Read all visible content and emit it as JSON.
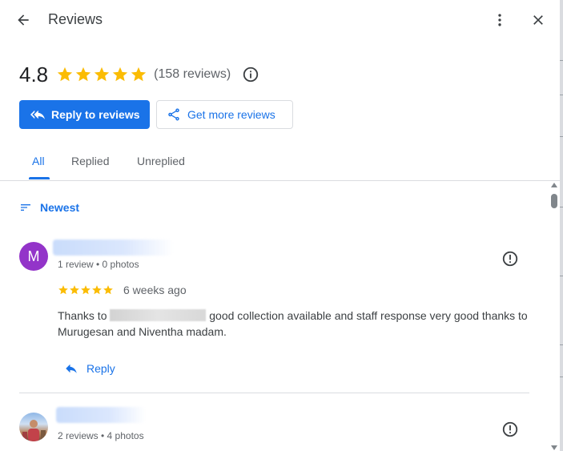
{
  "header": {
    "title": "Reviews",
    "back_icon": "arrow-back-icon",
    "more_icon": "more-vert-icon",
    "close_icon": "close-icon"
  },
  "summary": {
    "rating": "4.8",
    "stars": 5,
    "review_count": "(158 reviews)",
    "info_icon": "info-icon"
  },
  "actions": {
    "reply_label": "Reply to reviews",
    "get_more_label": "Get more reviews"
  },
  "tabs": [
    {
      "label": "All",
      "active": true
    },
    {
      "label": "Replied",
      "active": false
    },
    {
      "label": "Unreplied",
      "active": false
    }
  ],
  "sort": {
    "label": "Newest",
    "icon": "sort-icon"
  },
  "reviews": [
    {
      "avatar_letter": "M",
      "avatar_color": "#9334c9",
      "meta": "1 review • 0 photos",
      "stars": 5,
      "time": "6 weeks ago",
      "text_before": "Thanks to",
      "text_after": "good collection available and staff response very good thanks to Murugesan and Niventha madam.",
      "reply_label": "Reply"
    },
    {
      "meta": "2 reviews • 4 photos"
    }
  ],
  "colors": {
    "accent": "#1a73e8",
    "star": "#fbbc04",
    "divider": "#dadce0"
  }
}
